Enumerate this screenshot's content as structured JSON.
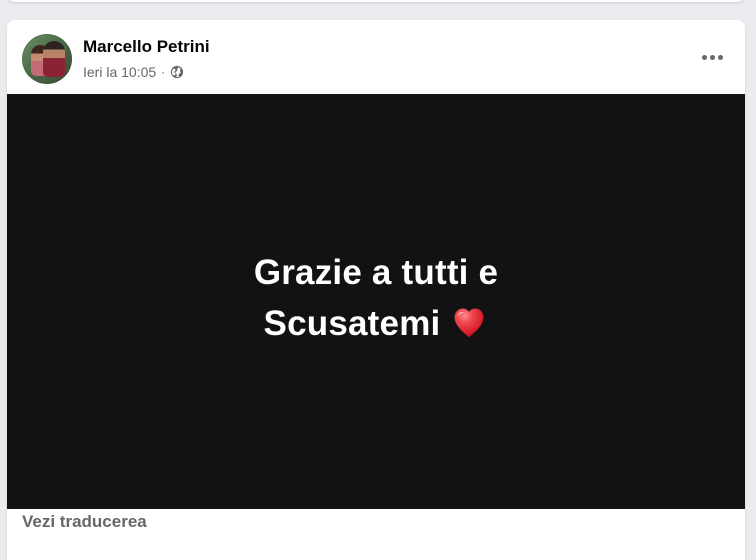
{
  "post": {
    "author_name": "Marcello Petrini",
    "timestamp": "Ieri la 10:05",
    "meta_separator": "·",
    "audience_icon": "globe-icon",
    "more_icon": "more-horizontal-icon",
    "image_text": {
      "line1": "Grazie a tutti e",
      "line2": "Scusatemi",
      "emoji": "red-heart-icon"
    },
    "translate_label": "Vezi traducerea"
  },
  "colors": {
    "page_background": "#e9ebee",
    "card_background": "#ffffff",
    "image_background": "#121212",
    "primary_text": "#050505",
    "secondary_text": "#65676b",
    "image_text": "#ffffff",
    "heart": "#e7353c"
  }
}
